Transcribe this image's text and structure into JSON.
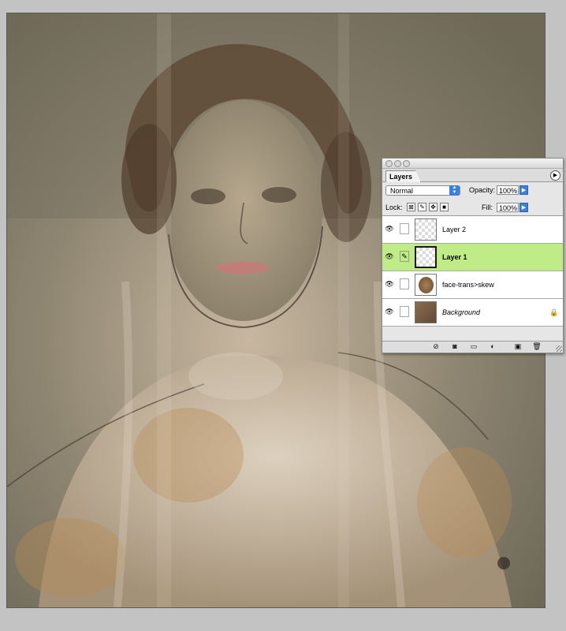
{
  "palette": {
    "tab_label": "Layers",
    "blend_mode": "Normal",
    "opacity_label": "Opacity:",
    "opacity_value": "100%",
    "lock_label": "Lock:",
    "fill_label": "Fill:",
    "fill_value": "100%",
    "layers": [
      {
        "name": "Layer 2"
      },
      {
        "name": "Layer 1"
      },
      {
        "name": "face-trans>skew"
      },
      {
        "name": "Background"
      }
    ],
    "selected_layer": "Layer 1",
    "selected_color": "#c0ec88",
    "icons": {
      "menu": "palette-menu-icon",
      "eye": "eye-icon",
      "brush": "brush-link-icon",
      "lock": "padlock-icon",
      "bottom": [
        "layer-style-icon",
        "layer-mask-icon",
        "new-group-icon",
        "adjustment-layer-icon",
        "new-layer-icon",
        "trash-icon"
      ]
    }
  },
  "canvas": {
    "description_color": "#7f7a68"
  }
}
